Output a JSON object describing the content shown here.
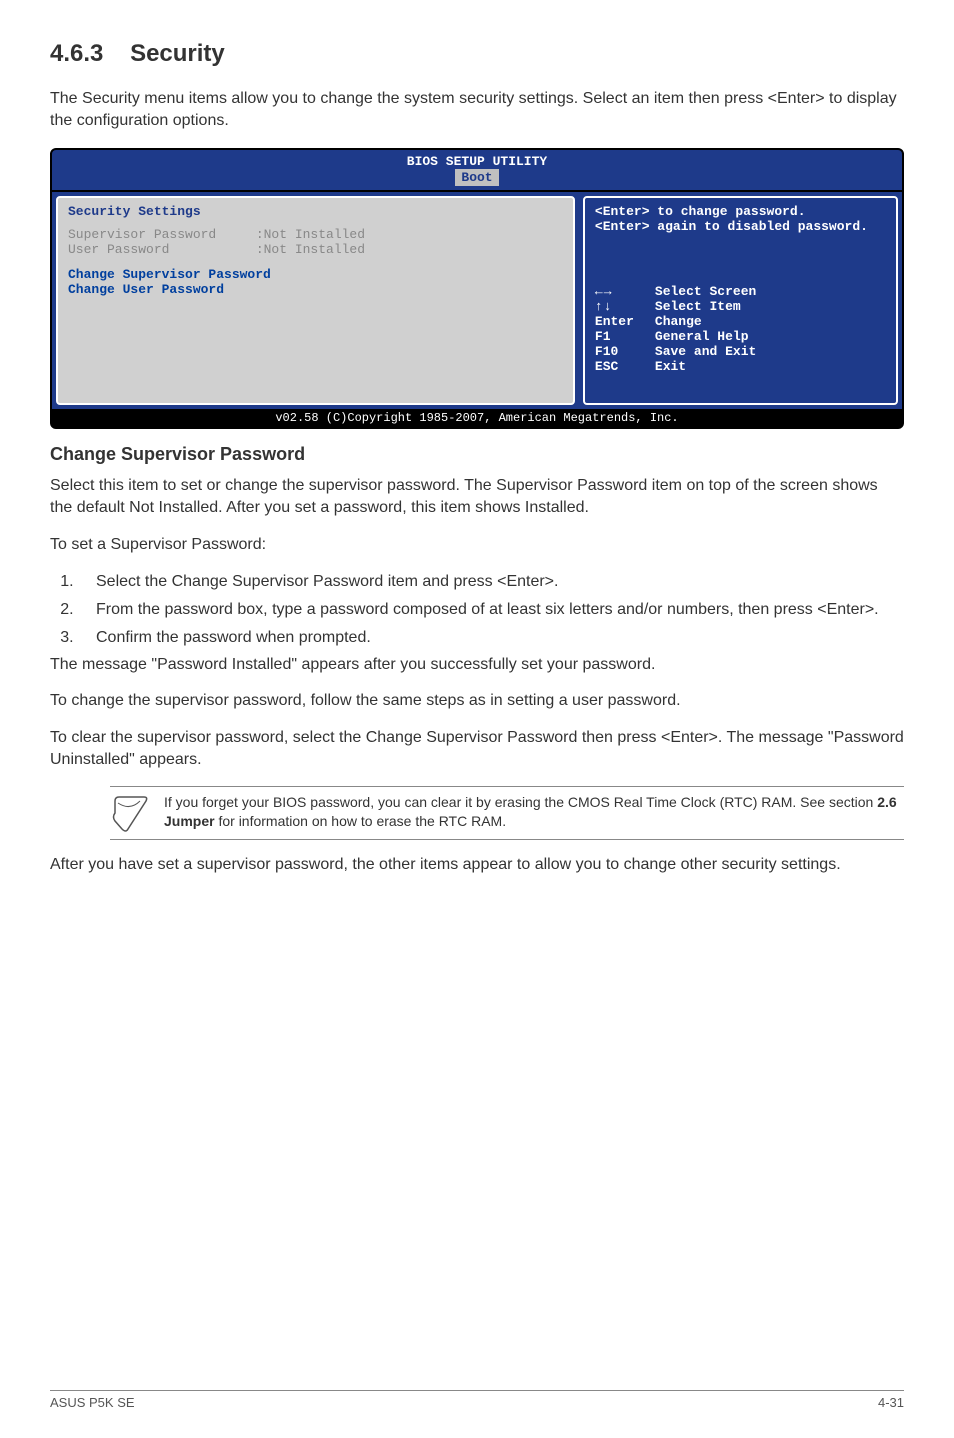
{
  "section": {
    "number": "4.6.3",
    "title": "Security"
  },
  "intro": "The Security menu items allow you to change the system security settings. Select an item then press <Enter> to display the configuration options.",
  "bios": {
    "title": "BIOS SETUP UTILITY",
    "tab": "Boot",
    "left": {
      "heading": "Security Settings",
      "rows": [
        {
          "label": "Supervisor Password",
          "value": ":Not Installed"
        },
        {
          "label": "User Password",
          "value": ":Not Installed"
        }
      ],
      "menu": [
        "Change Supervisor Password",
        "Change User Password"
      ]
    },
    "right": {
      "help": "<Enter> to change password.\n<Enter> again to disabled password.",
      "nav": [
        {
          "key": "←→",
          "desc": "Select Screen"
        },
        {
          "key": "↑↓",
          "desc": "Select Item"
        },
        {
          "key": "Enter",
          "desc": "Change"
        },
        {
          "key": "F1",
          "desc": "General Help"
        },
        {
          "key": "F10",
          "desc": "Save and Exit"
        },
        {
          "key": "ESC",
          "desc": "Exit"
        }
      ]
    },
    "footer": "v02.58 (C)Copyright 1985-2007, American Megatrends, Inc."
  },
  "subheading": "Change Supervisor Password",
  "body": {
    "p1": "Select this item to set or change the supervisor password. The Supervisor Password item on top of the screen shows the default Not Installed. After you set a password, this item shows Installed.",
    "p2": "To set a Supervisor Password:",
    "ol": [
      "Select the Change Supervisor Password item and press <Enter>.",
      "From the password box, type a password composed of at least six letters and/or numbers, then press <Enter>.",
      "Confirm the password when prompted."
    ],
    "p3": "The message \"Password Installed\" appears after you successfully set your password.",
    "p4": "To change the supervisor password, follow the same steps as in setting a user password.",
    "p5": "To clear the supervisor password, select the Change Supervisor Password then press <Enter>. The message \"Password Uninstalled\" appears.",
    "note": "If you forget your BIOS password, you can clear it by erasing the CMOS Real Time Clock (RTC) RAM. See section 2.6 Jumper for information on how to erase the RTC RAM.",
    "p6": "After you have set a supervisor password, the other items appear to allow you to change other security settings."
  },
  "footer": {
    "left": "ASUS P5K SE",
    "right": "4-31"
  }
}
